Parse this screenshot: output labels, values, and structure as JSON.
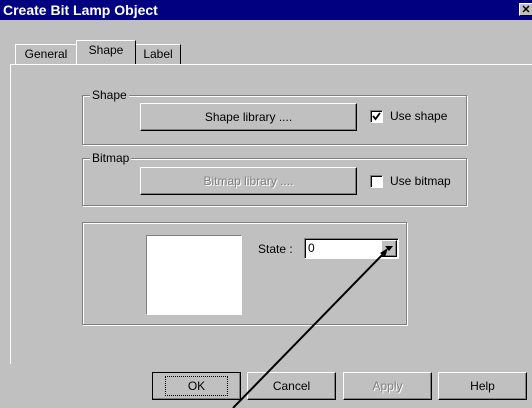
{
  "window": {
    "title": "Create Bit Lamp  Object",
    "close_glyph": "✕"
  },
  "tabs": [
    {
      "label": "General",
      "active": false
    },
    {
      "label": "Shape",
      "active": true
    },
    {
      "label": "Label",
      "active": false
    }
  ],
  "shape_group": {
    "label": "Shape",
    "library_button": "Shape  library ....",
    "use_label": "Use shape",
    "use_checked": true
  },
  "bitmap_group": {
    "label": "Bitmap",
    "library_button": "Bitmap  library ....",
    "use_label": "Use bitmap",
    "use_checked": false
  },
  "preview": {
    "state_label": "State :",
    "state_value": "0"
  },
  "footer": {
    "ok": "OK",
    "cancel": "Cancel",
    "apply": "Apply",
    "help": "Help"
  }
}
